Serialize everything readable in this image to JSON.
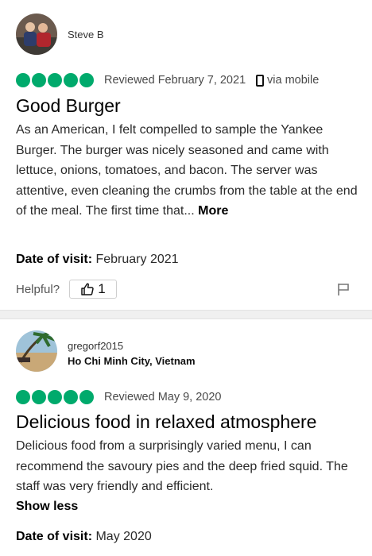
{
  "reviews": [
    {
      "username": "Steve B",
      "location": "",
      "rating": 5,
      "reviewed_date": "Reviewed February 7, 2021",
      "via": "via mobile",
      "title": "Good Burger",
      "body": "As an American, I felt compelled to sample the Yankee Burger. The burger was nicely seasoned and came with lettuce, onions, tomatoes, and bacon. The server was attentive, even cleaning the crumbs from the table at the end of the meal. The first time that...",
      "more_label": "More",
      "visit_label": "Date of visit:",
      "visit_value": "February 2021",
      "helpful_label": "Helpful?",
      "helpful_count": "1"
    },
    {
      "username": "gregorf2015",
      "location": "Ho Chi Minh City, Vietnam",
      "rating": 5,
      "reviewed_date": "Reviewed May 9, 2020",
      "title": "Delicious food in relaxed atmosphere",
      "body": "Delicious food from a surprisingly varied menu, I can recommend the savoury pies and the deep fried squid. The staff was very friendly and efficient.",
      "show_less_label": "Show less",
      "visit_label": "Date of visit:",
      "visit_value": "May 2020"
    }
  ],
  "colors": {
    "rating_bubble": "#00aa6c",
    "divider": "#f0f0f0"
  }
}
